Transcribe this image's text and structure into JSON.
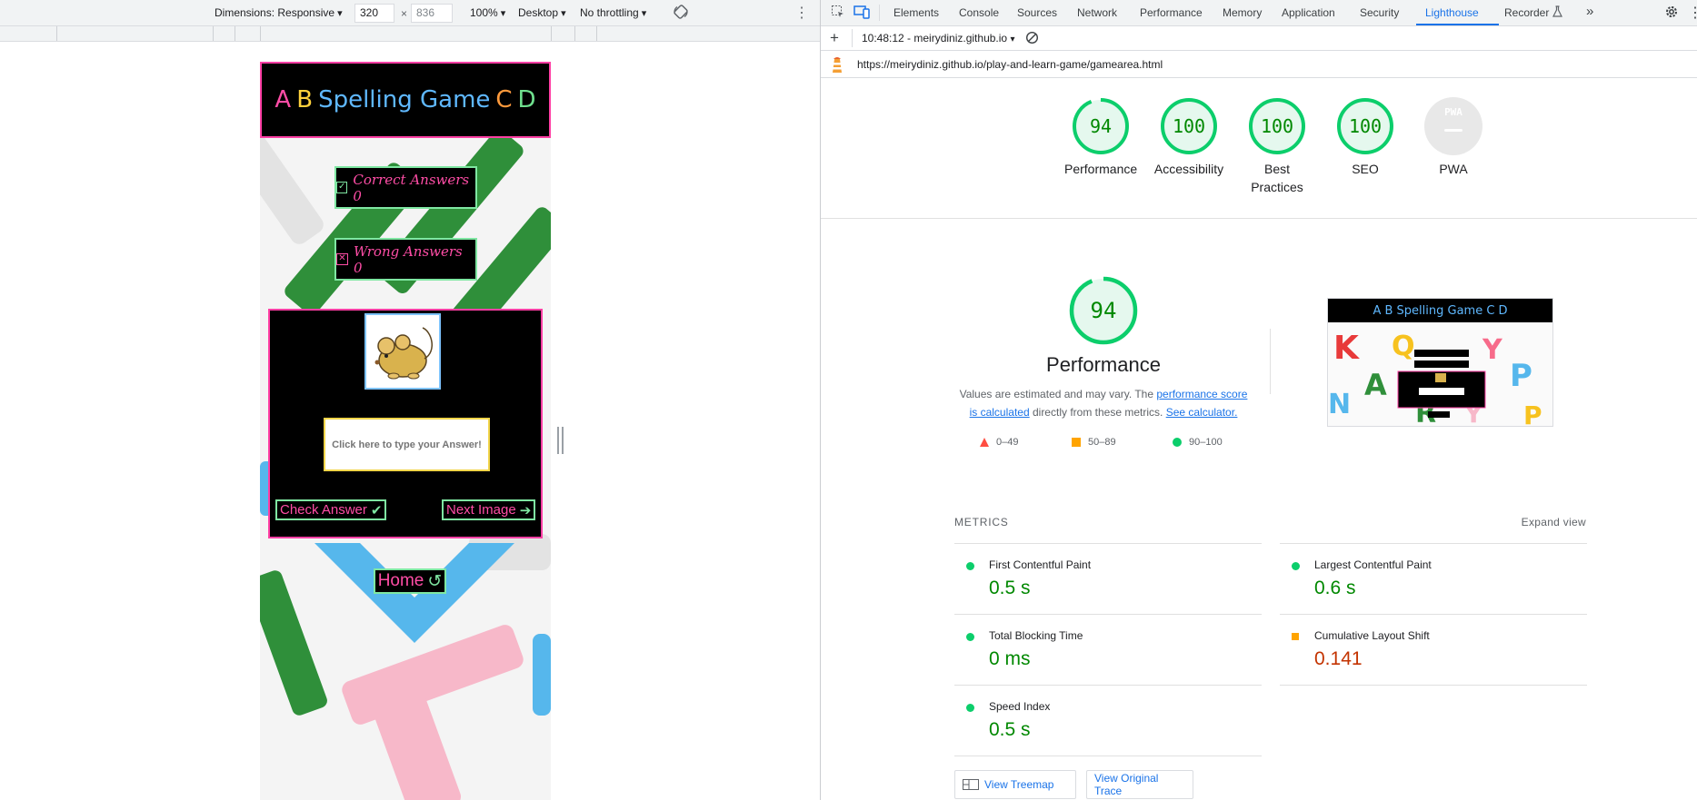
{
  "device_toolbar": {
    "dimensions_label": "Dimensions: Responsive",
    "width_value": "320",
    "times_sign": "×",
    "height_value": "836",
    "zoom": "100%",
    "device_type": "Desktop",
    "throttling": "No throttling"
  },
  "page": {
    "title_letters_left": [
      "A",
      "B"
    ],
    "title_main": "Spelling Game",
    "title_letters_right": [
      "C",
      "D"
    ],
    "correct_label": "Correct Answers 0",
    "wrong_label": "Wrong Answers 0",
    "answer_placeholder": "Click here to type your Answer!",
    "check_answer": "Check Answer",
    "next_image": "Next Image",
    "home": "Home"
  },
  "devtools": {
    "tabs": [
      "Elements",
      "Console",
      "Sources",
      "Network",
      "Performance",
      "Memory",
      "Application",
      "Security",
      "Lighthouse",
      "Recorder"
    ],
    "active_tab": "Lighthouse",
    "report_time": "10:48:12 - meirydiniz.github.io",
    "url": "https://meirydiniz.github.io/play-and-learn-game/gamearea.html",
    "gauges": [
      {
        "score": "94",
        "label": "Performance"
      },
      {
        "score": "100",
        "label": "Accessibility"
      },
      {
        "score": "100",
        "label": "Best Practices"
      },
      {
        "score": "100",
        "label": "SEO"
      },
      {
        "score": "PWA",
        "label": "PWA"
      }
    ],
    "performance": {
      "score": "94",
      "title": "Performance",
      "desc_1": "Values are estimated and may vary. The ",
      "desc_link_1": "performance score is calculated",
      "desc_2": " directly from these metrics. ",
      "desc_link_2": "See calculator."
    },
    "legend": [
      {
        "range": "0–49",
        "color": "#ff4e42"
      },
      {
        "range": "50–89",
        "color": "#ffa400"
      },
      {
        "range": "90–100",
        "color": "#0cce6b"
      }
    ],
    "screenshot_title": "A B Spelling Game C D",
    "metrics_heading": "METRICS",
    "expand_view": "Expand view",
    "metrics": [
      {
        "name": "First Contentful Paint",
        "value": "0.5 s",
        "status": "pass"
      },
      {
        "name": "Largest Contentful Paint",
        "value": "0.6 s",
        "status": "pass"
      },
      {
        "name": "Total Blocking Time",
        "value": "0 ms",
        "status": "pass"
      },
      {
        "name": "Cumulative Layout Shift",
        "value": "0.141",
        "status": "average"
      },
      {
        "name": "Speed Index",
        "value": "0.5 s",
        "status": "pass"
      }
    ],
    "view_treemap": "View Treemap",
    "view_trace": "View Original Trace"
  },
  "colors": {
    "accent_blue": "#1a73e8",
    "pass_green": "#0cce6b",
    "average_orange": "#ffa400",
    "game_pink": "#ff4da6",
    "game_green_border": "#7fe7a2"
  }
}
